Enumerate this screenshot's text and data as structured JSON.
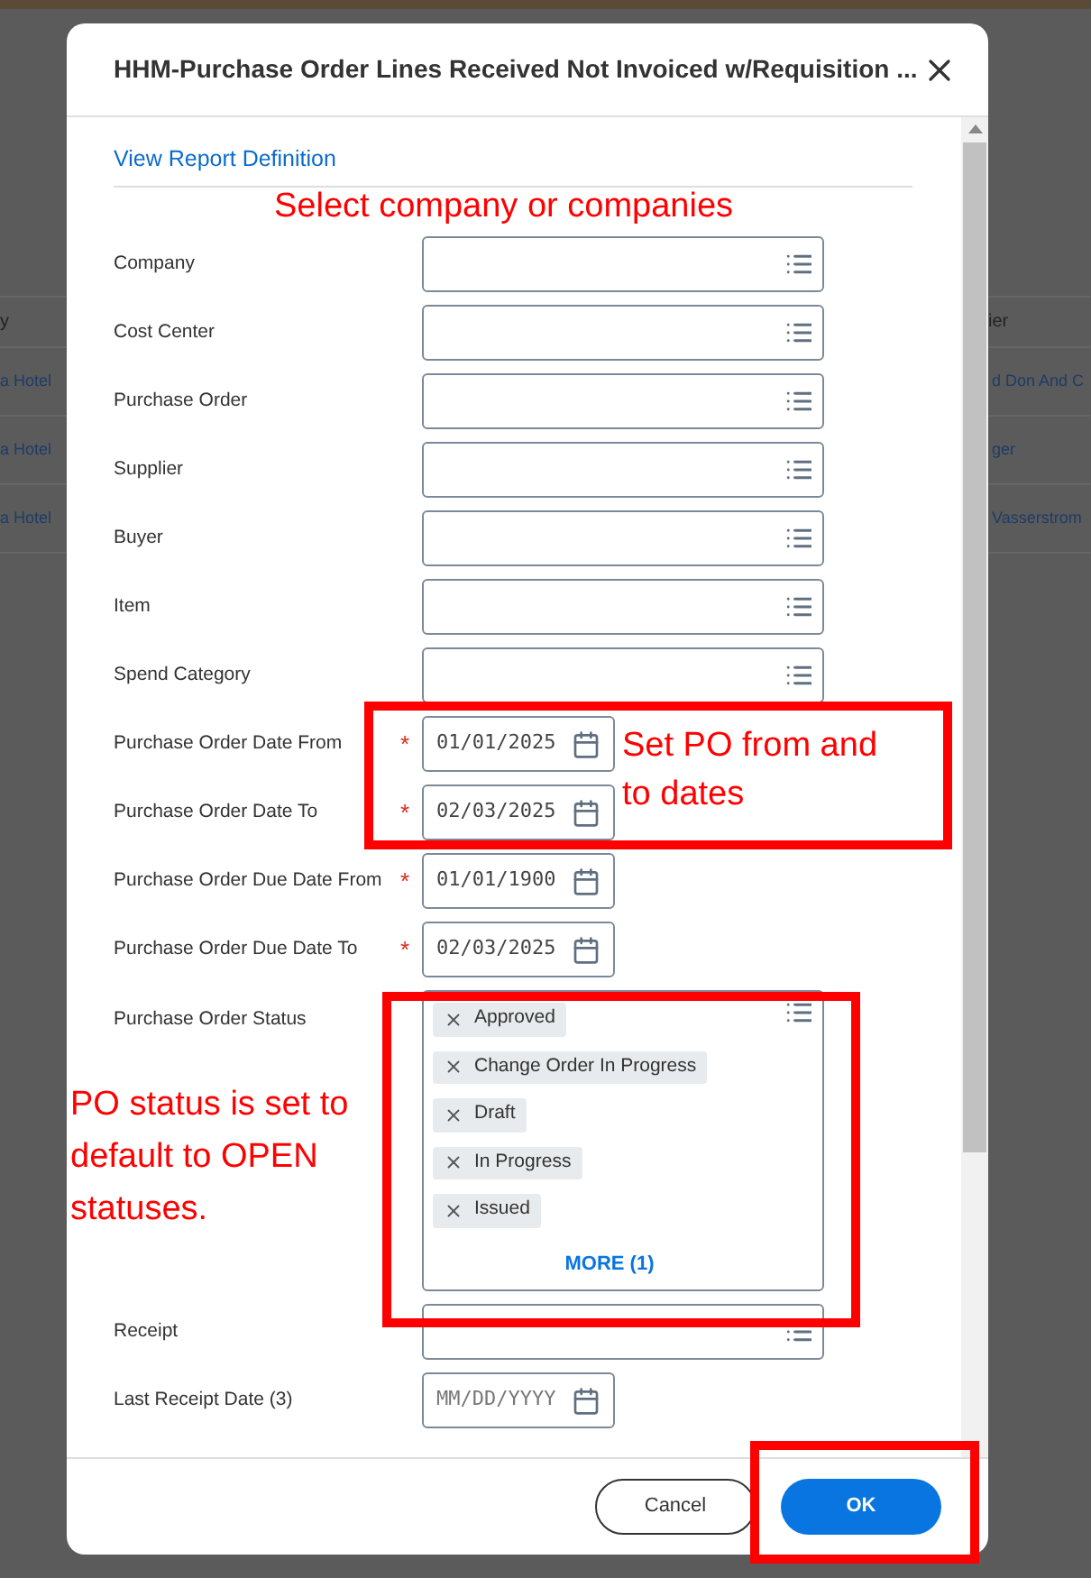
{
  "background": {
    "left_header": "y",
    "right_header": "ier",
    "rows": [
      {
        "left": "a Hotel",
        "right": "d Don And C"
      },
      {
        "left": "a Hotel",
        "right": "ger"
      },
      {
        "left": "a Hotel",
        "right": "Vasserstrom"
      }
    ]
  },
  "dialog": {
    "title": "HHM-Purchase Order Lines Received Not Invoiced w/Requisition ...",
    "link": "View Report Definition",
    "fields": [
      {
        "kind": "lookup",
        "label": "Company"
      },
      {
        "kind": "lookup",
        "label": "Cost Center"
      },
      {
        "kind": "lookup",
        "label": "Purchase Order"
      },
      {
        "kind": "lookup",
        "label": "Supplier"
      },
      {
        "kind": "lookup",
        "label": "Buyer"
      },
      {
        "kind": "lookup",
        "label": "Item"
      },
      {
        "kind": "lookup",
        "label": "Spend Category"
      },
      {
        "kind": "date",
        "label": "Purchase Order Date From",
        "required_mark": "*",
        "value": "01/01/2025"
      },
      {
        "kind": "date",
        "label": "Purchase Order Date To",
        "required_mark": "*",
        "value": "02/03/2025"
      },
      {
        "kind": "date",
        "label": "Purchase Order Due Date From",
        "required_mark": "*",
        "value": "01/01/1900"
      },
      {
        "kind": "date",
        "label": "Purchase Order Due Date To",
        "required_mark": "*",
        "value": "02/03/2025"
      },
      {
        "kind": "multiselect",
        "label": "Purchase Order Status",
        "chips": [
          "Approved",
          "Change Order In Progress",
          "Draft",
          "In Progress",
          "Issued"
        ],
        "more": "MORE (1)"
      },
      {
        "kind": "lookup",
        "label": "Receipt"
      },
      {
        "kind": "date",
        "label": "Last Receipt Date (3)",
        "placeholder": "MM/DD/YYYY"
      }
    ],
    "buttons": [
      {
        "label": "Cancel",
        "kind": "secondary"
      },
      {
        "label": "OK",
        "kind": "primary"
      }
    ]
  },
  "annotations": [
    {
      "text": "Select company or companies"
    },
    {
      "text": "Set PO from and\nto dates"
    },
    {
      "text": "PO status is set to\ndefault to OPEN\nstatuses."
    }
  ]
}
